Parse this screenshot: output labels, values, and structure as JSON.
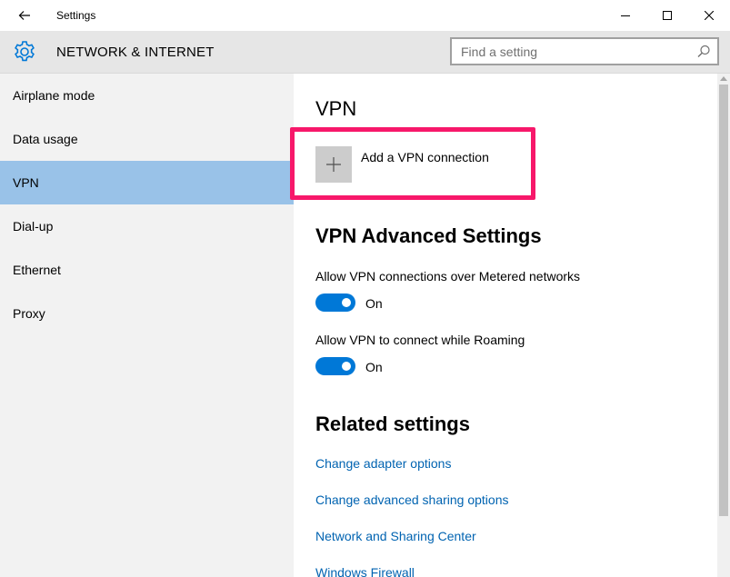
{
  "window": {
    "title": "Settings"
  },
  "header": {
    "section_title": "NETWORK & INTERNET",
    "search_placeholder": "Find a setting"
  },
  "sidebar": {
    "items": [
      {
        "label": "Airplane mode",
        "selected": false
      },
      {
        "label": "Data usage",
        "selected": false
      },
      {
        "label": "VPN",
        "selected": true
      },
      {
        "label": "Dial-up",
        "selected": false
      },
      {
        "label": "Ethernet",
        "selected": false
      },
      {
        "label": "Proxy",
        "selected": false
      }
    ]
  },
  "main": {
    "vpn_heading": "VPN",
    "add_vpn_label": "Add a VPN connection",
    "advanced_heading": "VPN Advanced Settings",
    "settings": [
      {
        "label": "Allow VPN connections over Metered networks",
        "state": "On"
      },
      {
        "label": "Allow VPN to connect while Roaming",
        "state": "On"
      }
    ],
    "related_heading": "Related settings",
    "links": [
      "Change adapter options",
      "Change advanced sharing options",
      "Network and Sharing Center",
      "Windows Firewall"
    ]
  },
  "colors": {
    "accent": "#0078d7",
    "link": "#0063b1",
    "selected_nav": "#99c2e8",
    "highlight": "#f7186a"
  },
  "icons": {
    "back": "back-arrow-icon",
    "minimize": "minimize-icon",
    "maximize": "maximize-icon",
    "close": "close-icon",
    "header": "gear-icon",
    "search": "search-icon",
    "add": "plus-icon"
  }
}
